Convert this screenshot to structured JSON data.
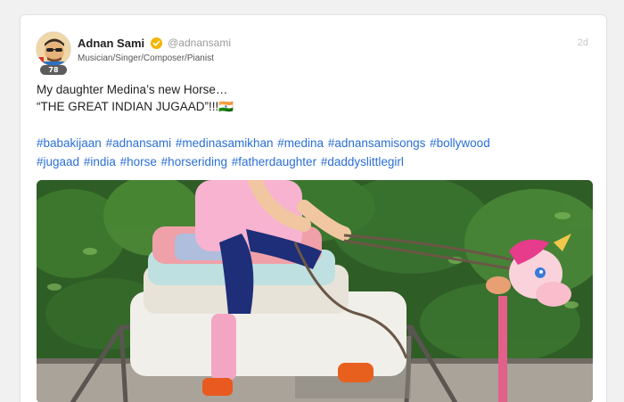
{
  "user": {
    "name": "Adnan Sami",
    "handle": "@adnansami",
    "description": "Musician/Singer/Composer/Pianist",
    "rank": "78",
    "verified": true
  },
  "post": {
    "timestamp": "2d",
    "lines": [
      "My daughter Medina’s new Horse…",
      "“THE GREAT INDIAN JUGAAD”!!!"
    ],
    "trailing_glyphs": "🇮🇳",
    "hashtags": [
      "#babakijaan",
      "#adnansami",
      "#medinasamikhan",
      "#medina",
      "#adnansamisongs",
      "#bollywood",
      "#jugaad",
      "#india",
      "#horse",
      "#horseriding",
      "#fatherdaughter",
      "#daddyslittlegirl"
    ]
  },
  "colors": {
    "hashtag": "#2a6fd6",
    "verified_badge": "#f4b400",
    "card_bg": "#ffffff",
    "page_bg": "#f1f1f1"
  }
}
